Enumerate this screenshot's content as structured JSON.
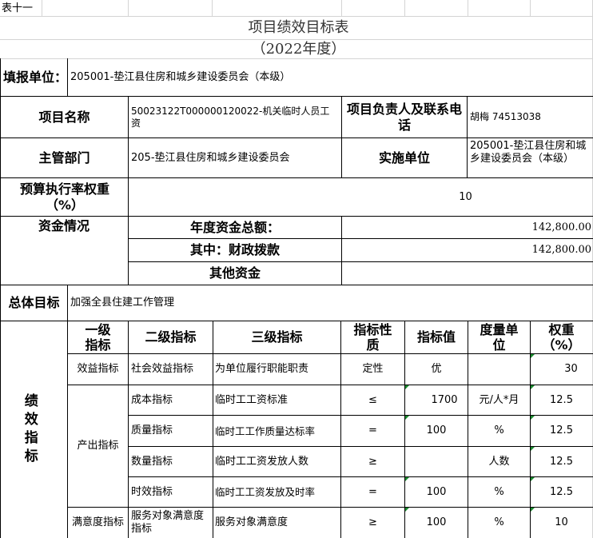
{
  "sheet_label": "表十一",
  "title": "项目绩效目标表",
  "subtitle": "（2022年度）",
  "unit": {
    "label": "填报单位：",
    "value": "205001-垫江县住房和城乡建设委员会（本级）"
  },
  "project": {
    "name_label": "项目名称",
    "name_value": "50023122T000000120022-机关临时人员工资",
    "leader_label": "项目负责人及联系电话",
    "leader_value": "胡梅 74513038"
  },
  "dept": {
    "label": "主管部门",
    "value": "205-垫江县住房和城乡建设委员会",
    "impl_label": "实施单位",
    "impl_value": "205001-垫江县住房和城乡建设委员会（本级）"
  },
  "budget": {
    "label": "预算执行率权重（%）",
    "value": "10"
  },
  "funds": {
    "label": "资金情况",
    "total_label": "年度资金总额：",
    "total_value": "142,800.00",
    "fiscal_label": "其中：财政拨款",
    "fiscal_value": "142,800.00",
    "other_label": "其他资金",
    "other_value": ""
  },
  "goal": {
    "label": "总体目标",
    "value": "加强全县住建工作管理"
  },
  "perf": {
    "label": "绩效指标",
    "headers": [
      "一级指标",
      "二级指标",
      "三级指标",
      "指标性质",
      "指标值",
      "度量单位",
      "权重（%）"
    ],
    "level1": [
      "效益指标",
      "产出指标",
      "满意度指标"
    ],
    "rows": [
      {
        "l2": "社会效益指标",
        "l3": "为单位履行职能职责",
        "nature": "定性",
        "value": "优",
        "unit": "",
        "weight": "30"
      },
      {
        "l2": "成本指标",
        "l3": "临时工工资标准",
        "nature": "≤",
        "value": "1700",
        "unit": "元/人*月",
        "weight": "12.5"
      },
      {
        "l2": "质量指标",
        "l3": "临时工工作质量达标率",
        "nature": "=",
        "value": "100",
        "unit": "%",
        "weight": "12.5"
      },
      {
        "l2": "数量指标",
        "l3": "临时工工资发放人数",
        "nature": "≥",
        "value": "",
        "unit": "人数",
        "weight": "12.5"
      },
      {
        "l2": "时效指标",
        "l3": "临时工工资发放及时率",
        "nature": "=",
        "value": "100",
        "unit": "%",
        "weight": "12.5"
      },
      {
        "l2": "服务对象满意度指标",
        "l3": "服务对象满意度",
        "nature": "≥",
        "value": "100",
        "unit": "%",
        "weight": "10"
      }
    ]
  },
  "colors": {
    "border": "#000000",
    "gridline": "#d4d4d4",
    "marker": "#1a8a2e",
    "title": "#333333"
  }
}
